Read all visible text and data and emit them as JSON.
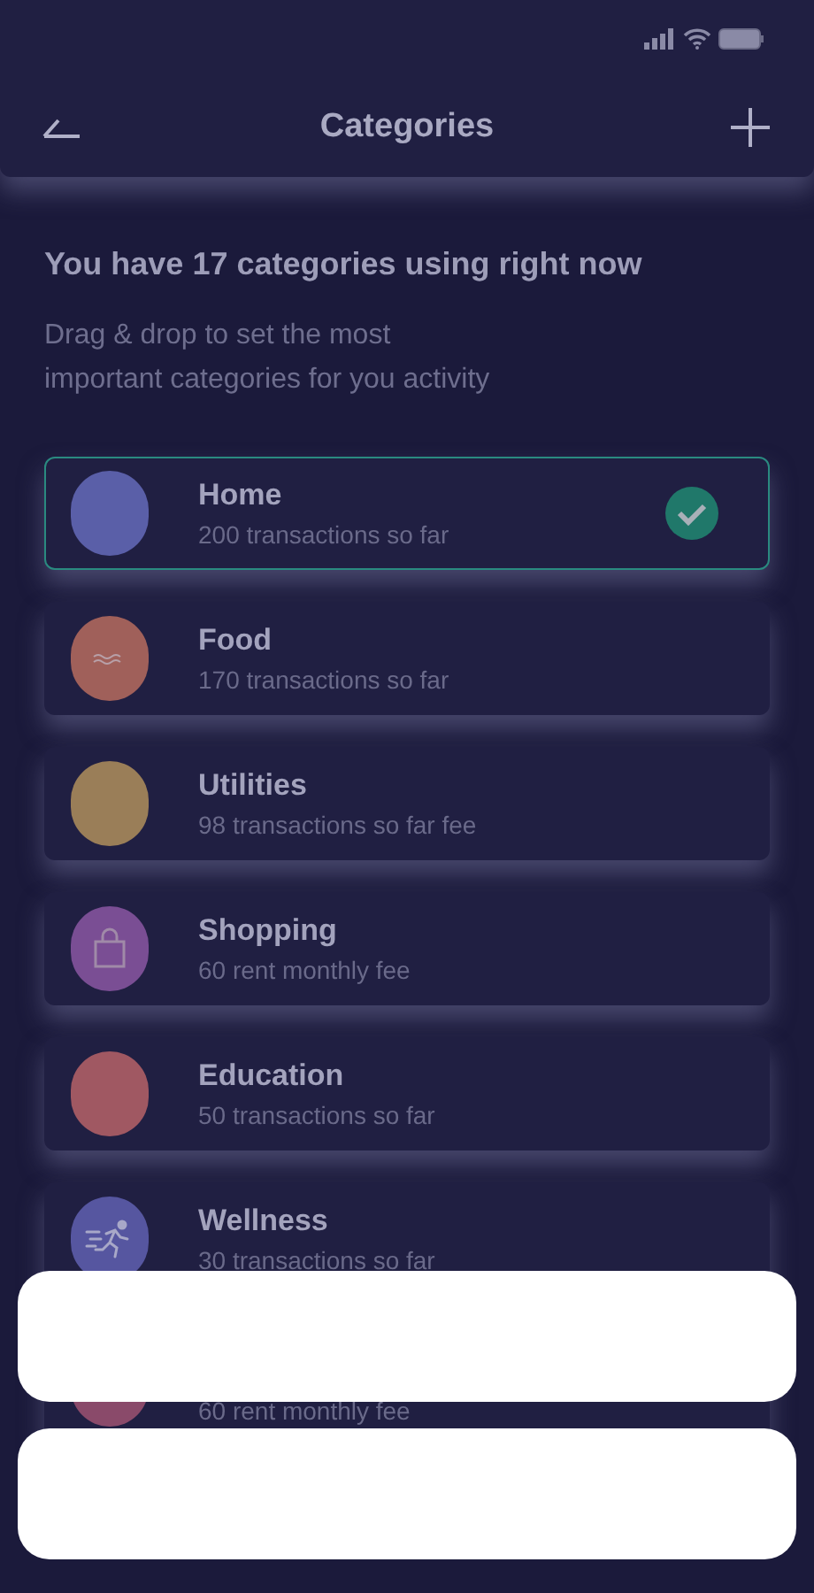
{
  "header": {
    "title": "Categories"
  },
  "intro": {
    "heading": "You have 17 categories using right now",
    "subtitle": "Drag & drop to set the most important categories for you activity"
  },
  "categories": [
    {
      "name": "Home",
      "subtitle": "200 transactions so far",
      "selected": true,
      "color": "#5a5fa8",
      "kind": "plain"
    },
    {
      "name": "Food",
      "subtitle": "170 transactions so far",
      "selected": false,
      "color": "#a0605a",
      "kind": "wave"
    },
    {
      "name": "Utilities",
      "subtitle": "98 transactions so far fee",
      "selected": false,
      "color": "#9a7e58",
      "kind": "plain"
    },
    {
      "name": "Shopping",
      "subtitle": "60 rent monthly fee",
      "selected": false,
      "color": "#7a4e94",
      "kind": "bag"
    },
    {
      "name": "Education",
      "subtitle": "50 transactions so far",
      "selected": false,
      "color": "#a05862",
      "kind": "plain"
    },
    {
      "name": "Wellness",
      "subtitle": "30 transactions so far",
      "selected": false,
      "color": "#5656a0",
      "kind": "runner"
    },
    {
      "subtitle": "60 rent monthly fee",
      "selected": false,
      "color": "#8a4a6a",
      "kind": "plain"
    }
  ],
  "sheet": {
    "options": [
      {
        "kind": "blank"
      },
      {
        "kind": "blank"
      }
    ]
  }
}
